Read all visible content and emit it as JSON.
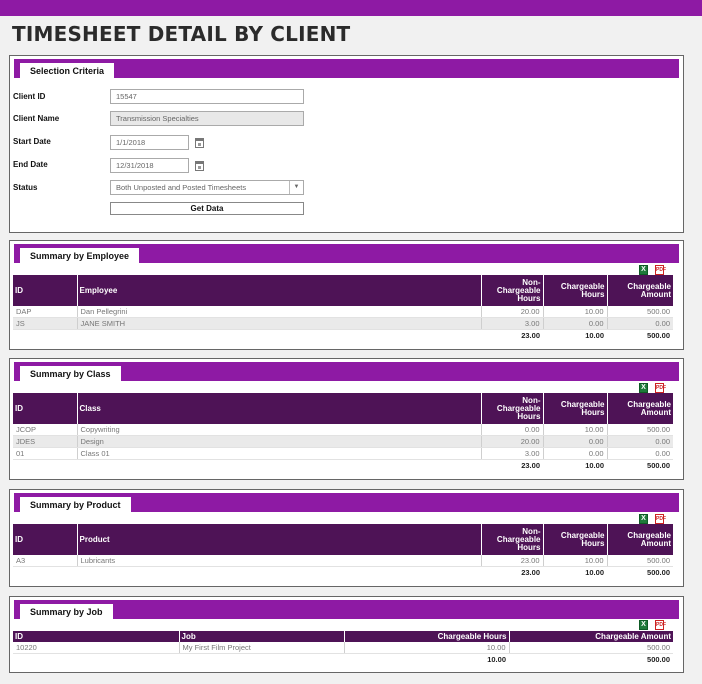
{
  "page": {
    "title": "TIMESHEET DETAIL BY CLIENT"
  },
  "colors": {
    "accent": "#8e1aa4",
    "header": "#4e1356"
  },
  "selection": {
    "tab": "Selection Criteria",
    "client_id": {
      "label": "Client ID",
      "value": "15547"
    },
    "client_name": {
      "label": "Client Name",
      "value": "Transmission Specialties"
    },
    "start_date": {
      "label": "Start Date",
      "value": "1/1/2018"
    },
    "end_date": {
      "label": "End Date",
      "value": "12/31/2018"
    },
    "status": {
      "label": "Status",
      "value": "Both Unposted and Posted Timesheets"
    },
    "get_data": "Get Data"
  },
  "export": {
    "excel": "X",
    "pdf": "PDF"
  },
  "employee": {
    "tab": "Summary by Employee",
    "headers": [
      "ID",
      "Employee",
      "Non-Chargeable Hours",
      "Chargeable Hours",
      "Chargeable Amount"
    ],
    "rows": [
      [
        "DAP",
        "Dan Pellegrini",
        "20.00",
        "10.00",
        "500.00"
      ],
      [
        "JS",
        "JANE SMITH",
        "3.00",
        "0.00",
        "0.00"
      ]
    ],
    "totals": [
      "23.00",
      "10.00",
      "500.00"
    ]
  },
  "class": {
    "tab": "Summary by Class",
    "headers": [
      "ID",
      "Class",
      "Non-Chargeable Hours",
      "Chargeable Hours",
      "Chargeable Amount"
    ],
    "rows": [
      [
        "JCOP",
        "Copywriting",
        "0.00",
        "10.00",
        "500.00"
      ],
      [
        "JDES",
        "Design",
        "20.00",
        "0.00",
        "0.00"
      ],
      [
        "01",
        "Class 01",
        "3.00",
        "0.00",
        "0.00"
      ]
    ],
    "totals": [
      "23.00",
      "10.00",
      "500.00"
    ]
  },
  "product": {
    "tab": "Summary by Product",
    "headers": [
      "ID",
      "Product",
      "Non-Chargeable Hours",
      "Chargeable Hours",
      "Chargeable Amount"
    ],
    "rows": [
      [
        "A3",
        "Lubricants",
        "23.00",
        "10.00",
        "500.00"
      ]
    ],
    "totals": [
      "23.00",
      "10.00",
      "500.00"
    ]
  },
  "job": {
    "tab": "Summary by Job",
    "headers": [
      "ID",
      "Job",
      "Chargeable Hours",
      "Chargeable Amount"
    ],
    "rows": [
      [
        "10220",
        "My First Film Project",
        "10.00",
        "500.00"
      ]
    ],
    "totals": [
      "10.00",
      "500.00"
    ]
  }
}
